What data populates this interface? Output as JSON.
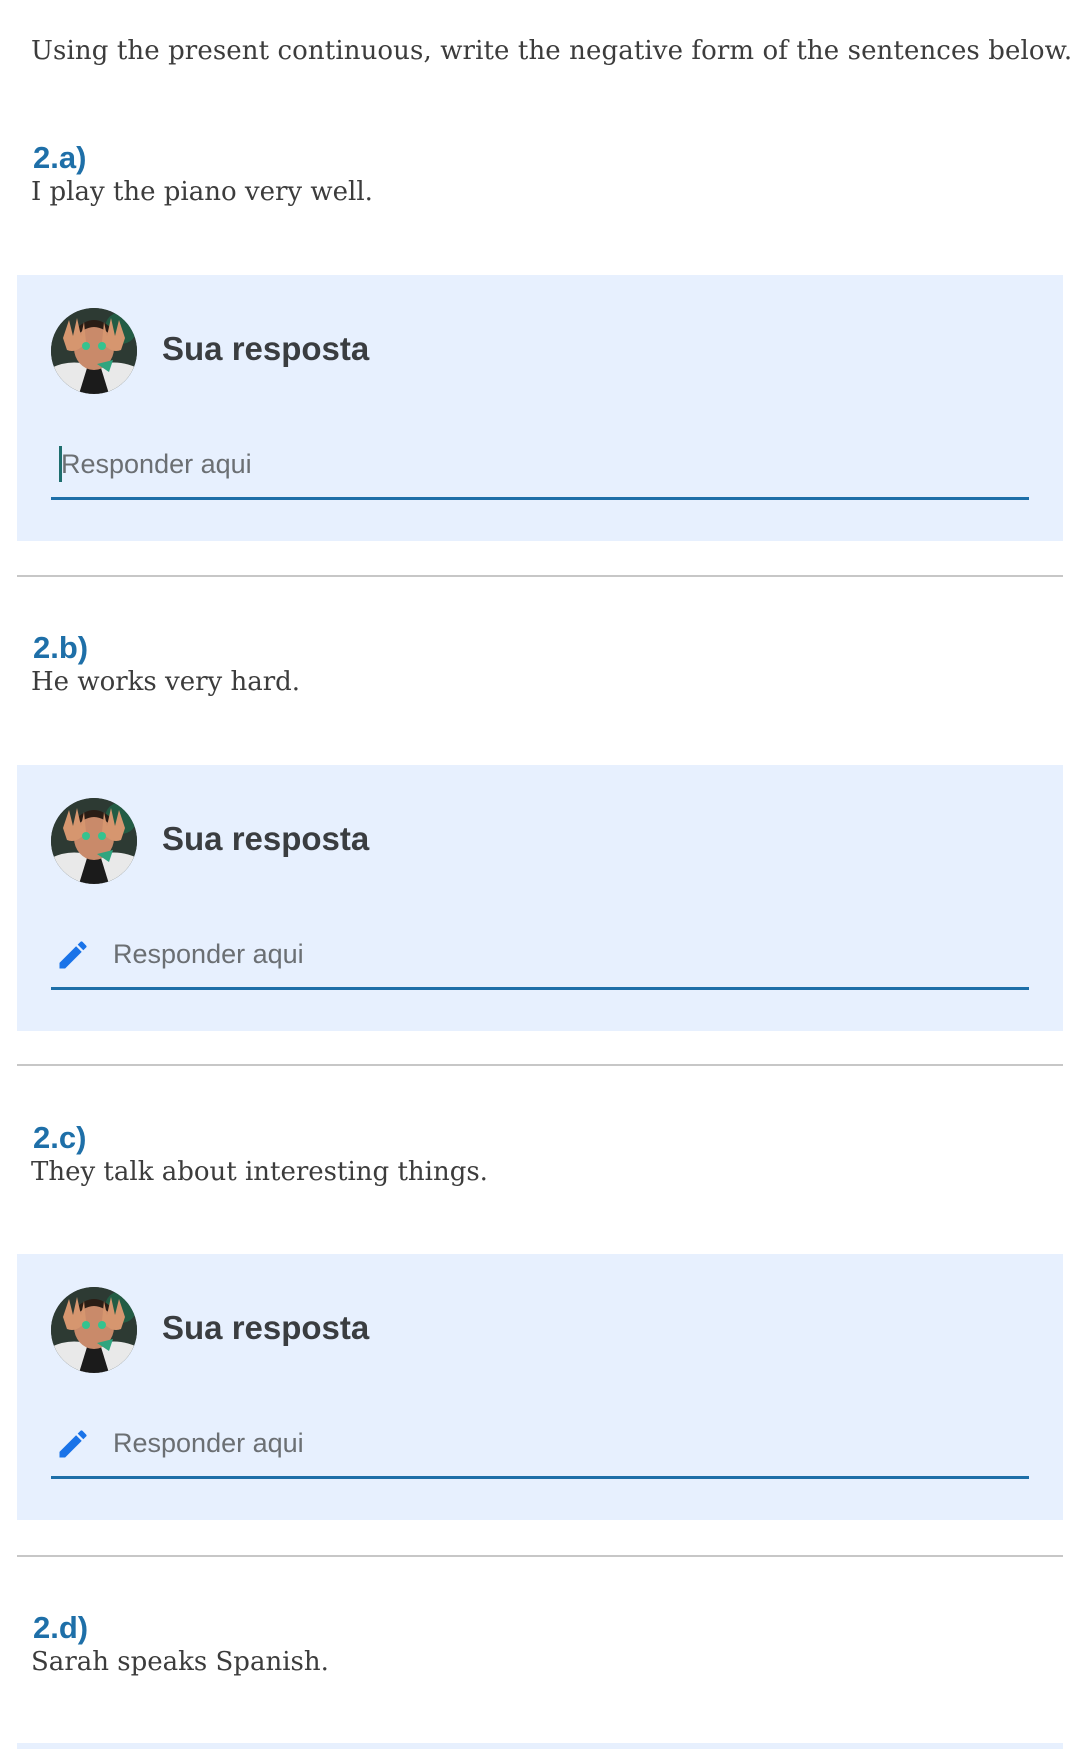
{
  "instructions": "Using the present continuous, write the negative form of the sentences below.",
  "questions": [
    {
      "number": "2.a)",
      "text": "I play the piano very well.",
      "answer": {
        "label": "Sua resposta",
        "placeholder": "Responder aqui",
        "focused": true
      }
    },
    {
      "number": "2.b)",
      "text": "He works very hard.",
      "answer": {
        "label": "Sua resposta",
        "placeholder": "Responder aqui",
        "focused": false
      }
    },
    {
      "number": "2.c)",
      "text": "They talk about interesting things.",
      "answer": {
        "label": "Sua resposta",
        "placeholder": "Responder aqui",
        "focused": false
      }
    },
    {
      "number": "2.d)",
      "text": "Sarah speaks Spanish."
    }
  ],
  "icons": {
    "avatar": "user-avatar",
    "edit": "pencil-icon"
  },
  "colors": {
    "accent": "#1e6fa8",
    "card_background": "#e7f0fe",
    "pencil": "#1a73e8",
    "divider": "#c7c7c7"
  }
}
